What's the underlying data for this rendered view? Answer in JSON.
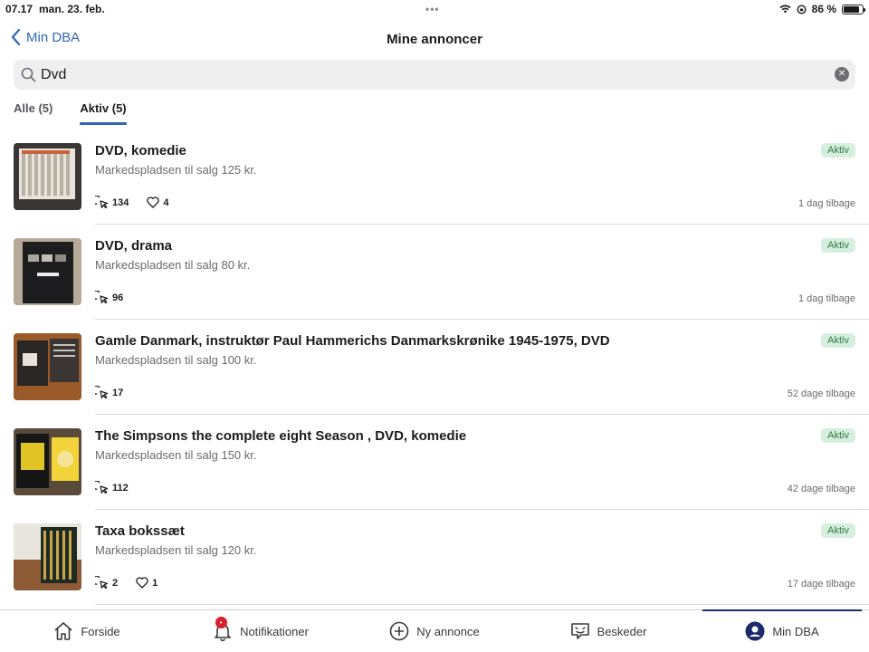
{
  "status": {
    "time": "07.17",
    "date": "man. 23. feb.",
    "battery": "86 %",
    "battery_level": 0.86
  },
  "header": {
    "back_label": "Min DBA",
    "title": "Mine annoncer"
  },
  "search": {
    "value": "Dvd",
    "placeholder": ""
  },
  "tabs": [
    {
      "label": "Alle (5)",
      "active": false
    },
    {
      "label": "Aktiv (5)",
      "active": true
    }
  ],
  "listings": [
    {
      "title": "DVD, komedie",
      "subtitle": "Markedspladsen til salg 125 kr.",
      "badge": "Aktiv",
      "views": "134",
      "likes": "4",
      "age": "1 dag tilbage"
    },
    {
      "title": "DVD, drama",
      "subtitle": "Markedspladsen til salg 80 kr.",
      "badge": "Aktiv",
      "views": "96",
      "likes": "",
      "age": "1 dag tilbage"
    },
    {
      "title": "Gamle Danmark, instruktør Paul Hammerichs Danmarkskrønike 1945-1975, DVD",
      "subtitle": "Markedspladsen til salg 100 kr.",
      "badge": "Aktiv",
      "views": "17",
      "likes": "",
      "age": "52 dage tilbage"
    },
    {
      "title": "The Simpsons the complete eight Season , DVD, komedie",
      "subtitle": "Markedspladsen til salg 150 kr.",
      "badge": "Aktiv",
      "views": "112",
      "likes": "",
      "age": "42 dage tilbage"
    },
    {
      "title": "Taxa bokssæt",
      "subtitle": "Markedspladsen til salg 120 kr.",
      "badge": "Aktiv",
      "views": "2",
      "likes": "1",
      "age": "17 dage tilbage"
    }
  ],
  "bottom_nav": [
    {
      "label": "Forside",
      "icon": "home-icon"
    },
    {
      "label": "Notifikationer",
      "icon": "bell-icon",
      "badge": "•"
    },
    {
      "label": "Ny annonce",
      "icon": "plus-circle-icon"
    },
    {
      "label": "Beskeder",
      "icon": "message-icon"
    },
    {
      "label": "Min DBA",
      "icon": "profile-icon",
      "active": true
    }
  ],
  "colors": {
    "accent": "#3165b8",
    "badge_bg": "#d5eedd",
    "badge_text": "#2f7b45",
    "nav_active": "#1b2a6b"
  }
}
